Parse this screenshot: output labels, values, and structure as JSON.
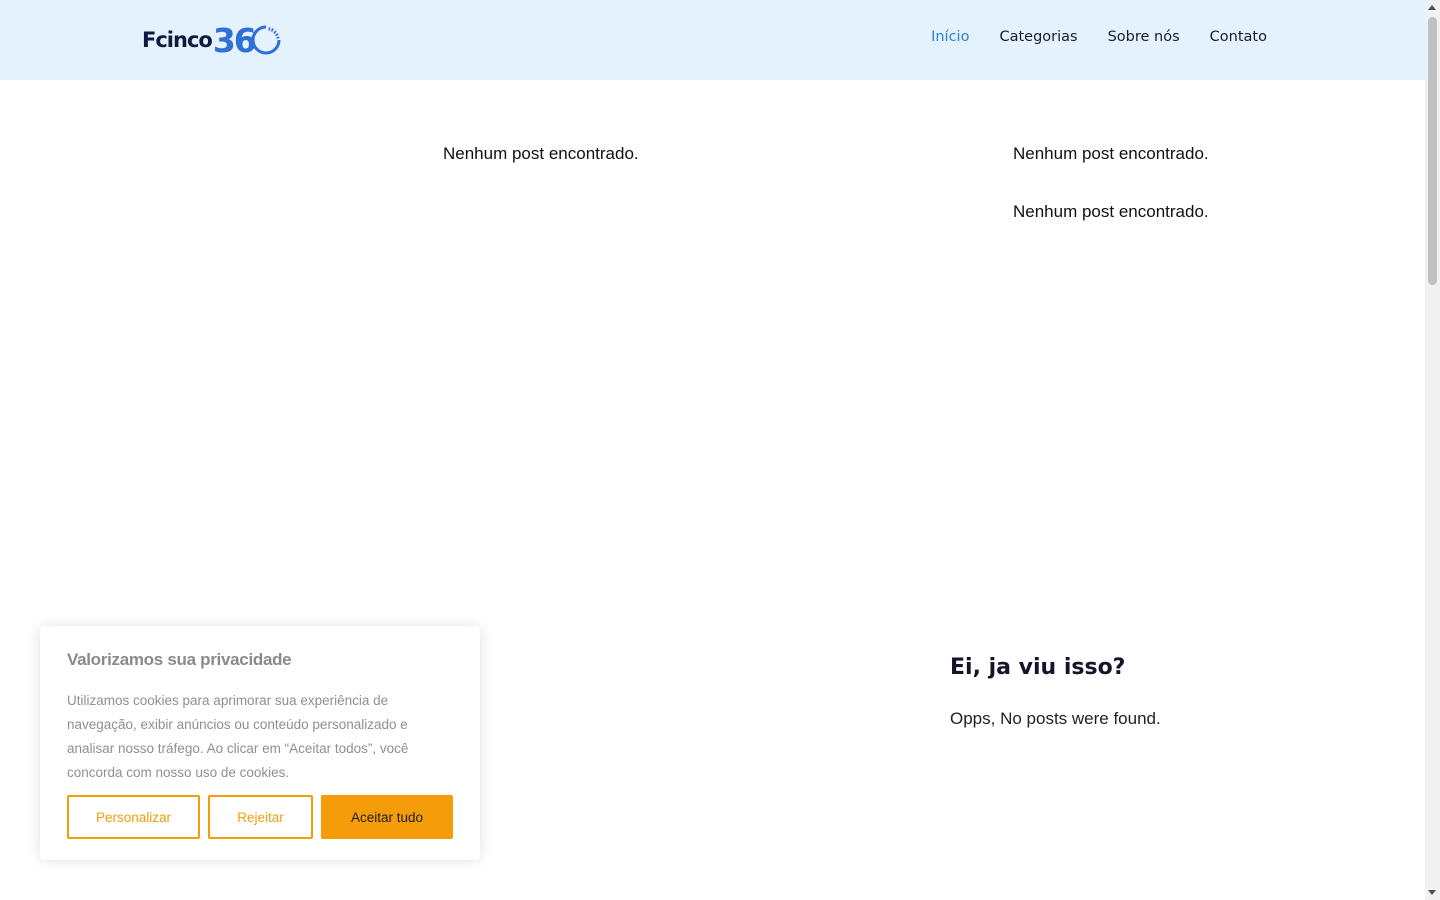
{
  "header": {
    "logo": {
      "text_prefix": "Fcinco",
      "text_number": "36",
      "icon": "ring-zero-icon",
      "brand_color": "#2f6fd6"
    },
    "nav": [
      {
        "label": "Início",
        "active": true
      },
      {
        "label": "Categorias",
        "active": false
      },
      {
        "label": "Sobre nós",
        "active": false
      },
      {
        "label": "Contato",
        "active": false
      }
    ],
    "background": "#e3f2fd"
  },
  "main": {
    "messages": [
      "Nenhum post encontrado.",
      "Nenhum post encontrado.",
      "Nenhum post encontrado."
    ]
  },
  "widget": {
    "title": "Ei, ja viu isso?",
    "text": "Opps, No posts were found."
  },
  "cookie_banner": {
    "title": "Valorizamos sua privacidade",
    "text": "Utilizamos cookies para aprimorar sua experiência de navegação, exibir anúncios ou conteúdo personalizado e analisar nosso tráfego. Ao clicar em “Aceitar todos”, você concorda com nosso uso de cookies.",
    "buttons": {
      "customize": "Personalizar",
      "reject": "Rejeitar",
      "accept": "Aceitar tudo"
    },
    "accent_color": "#f59c0a"
  }
}
